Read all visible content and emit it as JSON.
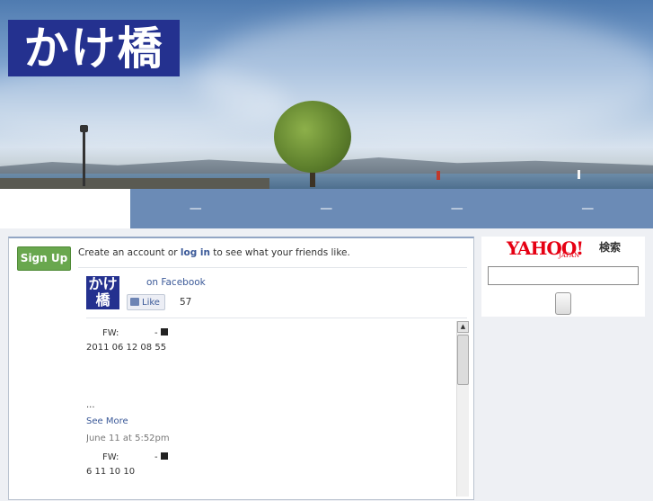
{
  "header": {
    "logo_text": "かけ橋"
  },
  "nav": {
    "items": [
      "—",
      "—",
      "—",
      "—"
    ]
  },
  "fb_widget": {
    "signup_label": "Sign Up",
    "create_text_before": "Create an account or ",
    "login_label": "log in",
    "create_text_after": " to see what your friends like.",
    "page_thumb_text": "かけ橋",
    "on_facebook_label": "on Facebook",
    "like_label": "Like",
    "like_count": "57",
    "posts": [
      {
        "prefix": "FW:",
        "dash": "-",
        "date": "2011 06 12  08 55",
        "ellipsis": "...",
        "see_more": "See More",
        "time": "June 11 at 5:52pm"
      },
      {
        "prefix": "FW:",
        "dash": "-",
        "date": "6 11 10 10"
      }
    ]
  },
  "yahoo": {
    "logo": "YAHOO!",
    "sub": "JAPAN",
    "search_label": "検索",
    "input_value": ""
  }
}
